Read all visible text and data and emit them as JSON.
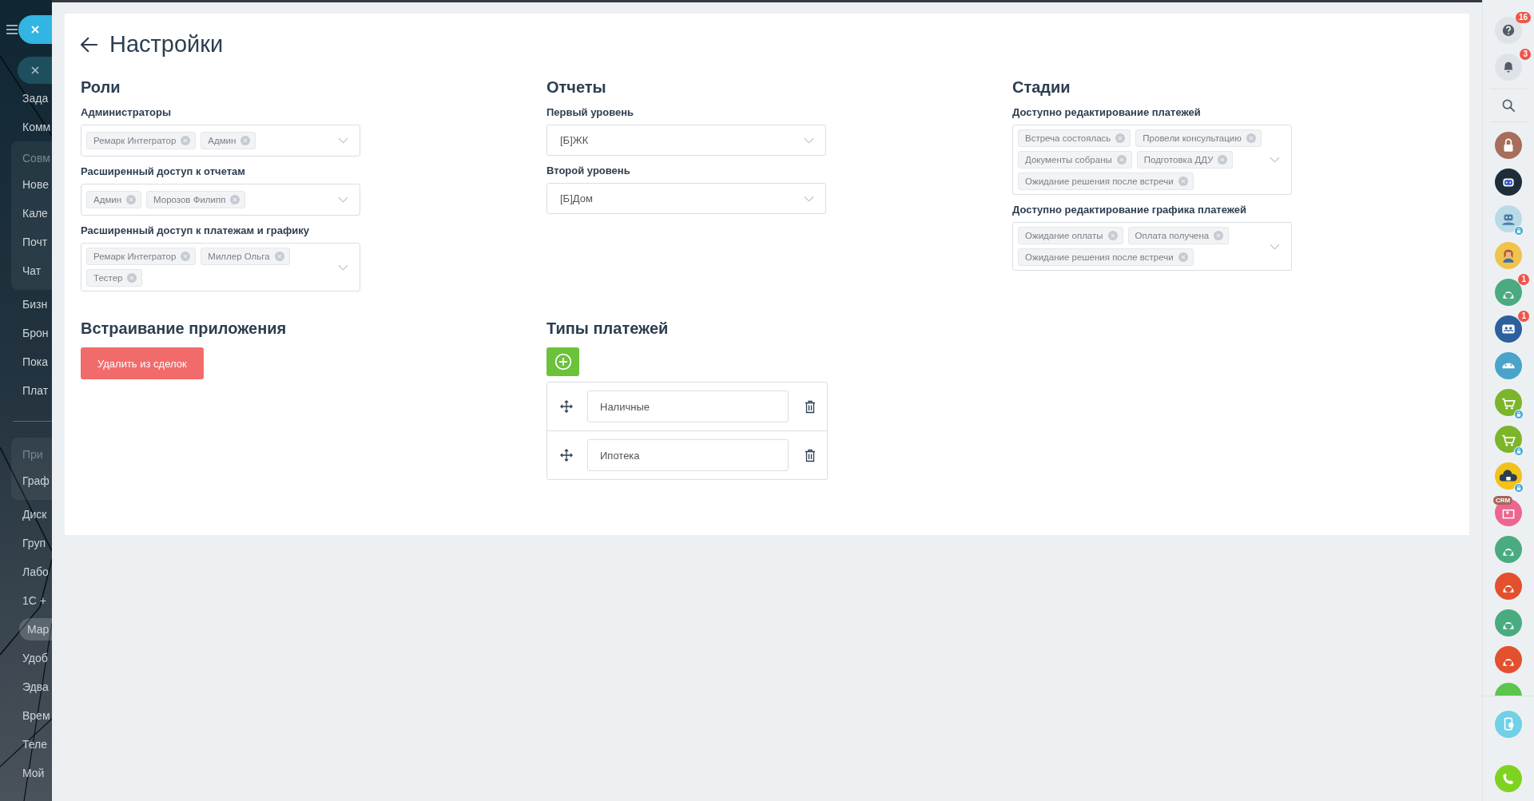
{
  "left_menu": {
    "entries": [
      {
        "kind": "item",
        "label": "Зада",
        "selected": false
      },
      {
        "kind": "item",
        "label": "Комм",
        "selected": false
      },
      {
        "kind": "group",
        "title": "Совм",
        "items": [
          {
            "label": "Нове",
            "selected": false
          },
          {
            "label": "Кале",
            "selected": false
          },
          {
            "label": "Почт",
            "selected": false
          },
          {
            "label": "Чат",
            "selected": false
          }
        ]
      },
      {
        "kind": "item",
        "label": "Бизн",
        "selected": false
      },
      {
        "kind": "item",
        "label": "Брон",
        "selected": false
      },
      {
        "kind": "item",
        "label": "Пока",
        "selected": false
      },
      {
        "kind": "item",
        "label": "Плат",
        "selected": false
      },
      {
        "kind": "divider"
      },
      {
        "kind": "group",
        "title": "При",
        "items": [
          {
            "label": "Граф",
            "selected": false
          }
        ]
      },
      {
        "kind": "item",
        "label": "Диск",
        "selected": false
      },
      {
        "kind": "item",
        "label": "Груп",
        "selected": false
      },
      {
        "kind": "item",
        "label": "Лабо",
        "selected": false
      },
      {
        "kind": "item",
        "label": "1С +",
        "selected": false
      },
      {
        "kind": "item",
        "label": "Мар",
        "selected": true
      },
      {
        "kind": "item",
        "label": "Удоб",
        "selected": false
      },
      {
        "kind": "item",
        "label": "Эдва",
        "selected": false
      },
      {
        "kind": "item",
        "label": "Врем",
        "selected": false
      },
      {
        "kind": "item",
        "label": "Теле",
        "selected": false
      },
      {
        "kind": "item",
        "label": "Мой",
        "selected": false
      }
    ]
  },
  "page": {
    "title": "Настройки",
    "columns": [
      {
        "heading": "Роли",
        "fields": [
          {
            "kind": "multi",
            "label": "Администраторы",
            "tags": [
              "Ремарк Интегратор",
              "Админ"
            ]
          },
          {
            "kind": "multi",
            "label": "Расширенный доступ к отчетам",
            "tags": [
              "Админ",
              "Морозов Филипп"
            ]
          },
          {
            "kind": "multi",
            "label": "Расширенный доступ к платежам и графику",
            "tags": [
              "Ремарк Интегратор",
              "Миллер Ольга",
              "Тестер"
            ]
          }
        ]
      },
      {
        "heading": "Отчеты",
        "fields": [
          {
            "kind": "single",
            "label": "Первый уровень",
            "value": "[Б]ЖК"
          },
          {
            "kind": "single",
            "label": "Второй уровень",
            "value": "[Б]Дом"
          }
        ]
      },
      {
        "heading": "Стадии",
        "fields": [
          {
            "kind": "multi",
            "label": "Доступно редактирование платежей",
            "tags": [
              "Встреча состоялась",
              "Провели консультацию",
              "Документы собраны",
              "Подготовка ДДУ",
              "Ожидание решения после встречи"
            ]
          },
          {
            "kind": "multi",
            "label": "Доступно редактирование графика платежей",
            "tags": [
              "Ожидание оплаты",
              "Оплата получена",
              "Ожидание решения после встречи"
            ]
          }
        ]
      }
    ],
    "embedding": {
      "heading": "Встраивание приложения",
      "button": "Удалить из сделок"
    },
    "payment_types": {
      "heading": "Типы платежей",
      "items": [
        "Наличные",
        "Ипотека"
      ]
    }
  },
  "right_bar": {
    "items": [
      {
        "kind": "help",
        "badge": "16"
      },
      {
        "kind": "bell",
        "badge": "3"
      },
      {
        "kind": "search"
      },
      {
        "kind": "lock",
        "color": "#a66e5b",
        "locked": false
      },
      {
        "kind": "robot",
        "color": "#1f2d3a",
        "locked": false
      },
      {
        "kind": "bot",
        "color": "#b9dbe8",
        "locked": true
      },
      {
        "kind": "person",
        "color": "#f0c44c",
        "locked": false
      },
      {
        "kind": "user",
        "color": "#4aab80",
        "locked": false,
        "badge": "1"
      },
      {
        "kind": "group",
        "color": "#2c5f9e",
        "locked": false,
        "badge": "1"
      },
      {
        "kind": "android",
        "color": "#4aa3c9",
        "locked": false
      },
      {
        "kind": "cart",
        "color": "#7db52a",
        "locked": true
      },
      {
        "kind": "cart",
        "color": "#7db52a",
        "locked": true
      },
      {
        "kind": "cloudlock",
        "color": "#f2c21b",
        "locked": true
      },
      {
        "kind": "crm",
        "color": "#ee6590",
        "locked": false,
        "label": "CRM"
      },
      {
        "kind": "user",
        "color": "#4aab80",
        "locked": false
      },
      {
        "kind": "user",
        "color": "#e2502e",
        "locked": false
      },
      {
        "kind": "user",
        "color": "#4aab80",
        "locked": false
      },
      {
        "kind": "user",
        "color": "#e2502e",
        "locked": false
      },
      {
        "kind": "user",
        "color": "#5cc54d",
        "locked": false,
        "cut": true
      }
    ],
    "footer": [
      {
        "kind": "phone",
        "color": "#6fd0e6"
      },
      {
        "kind": "call",
        "color": "#7ed321"
      }
    ]
  }
}
